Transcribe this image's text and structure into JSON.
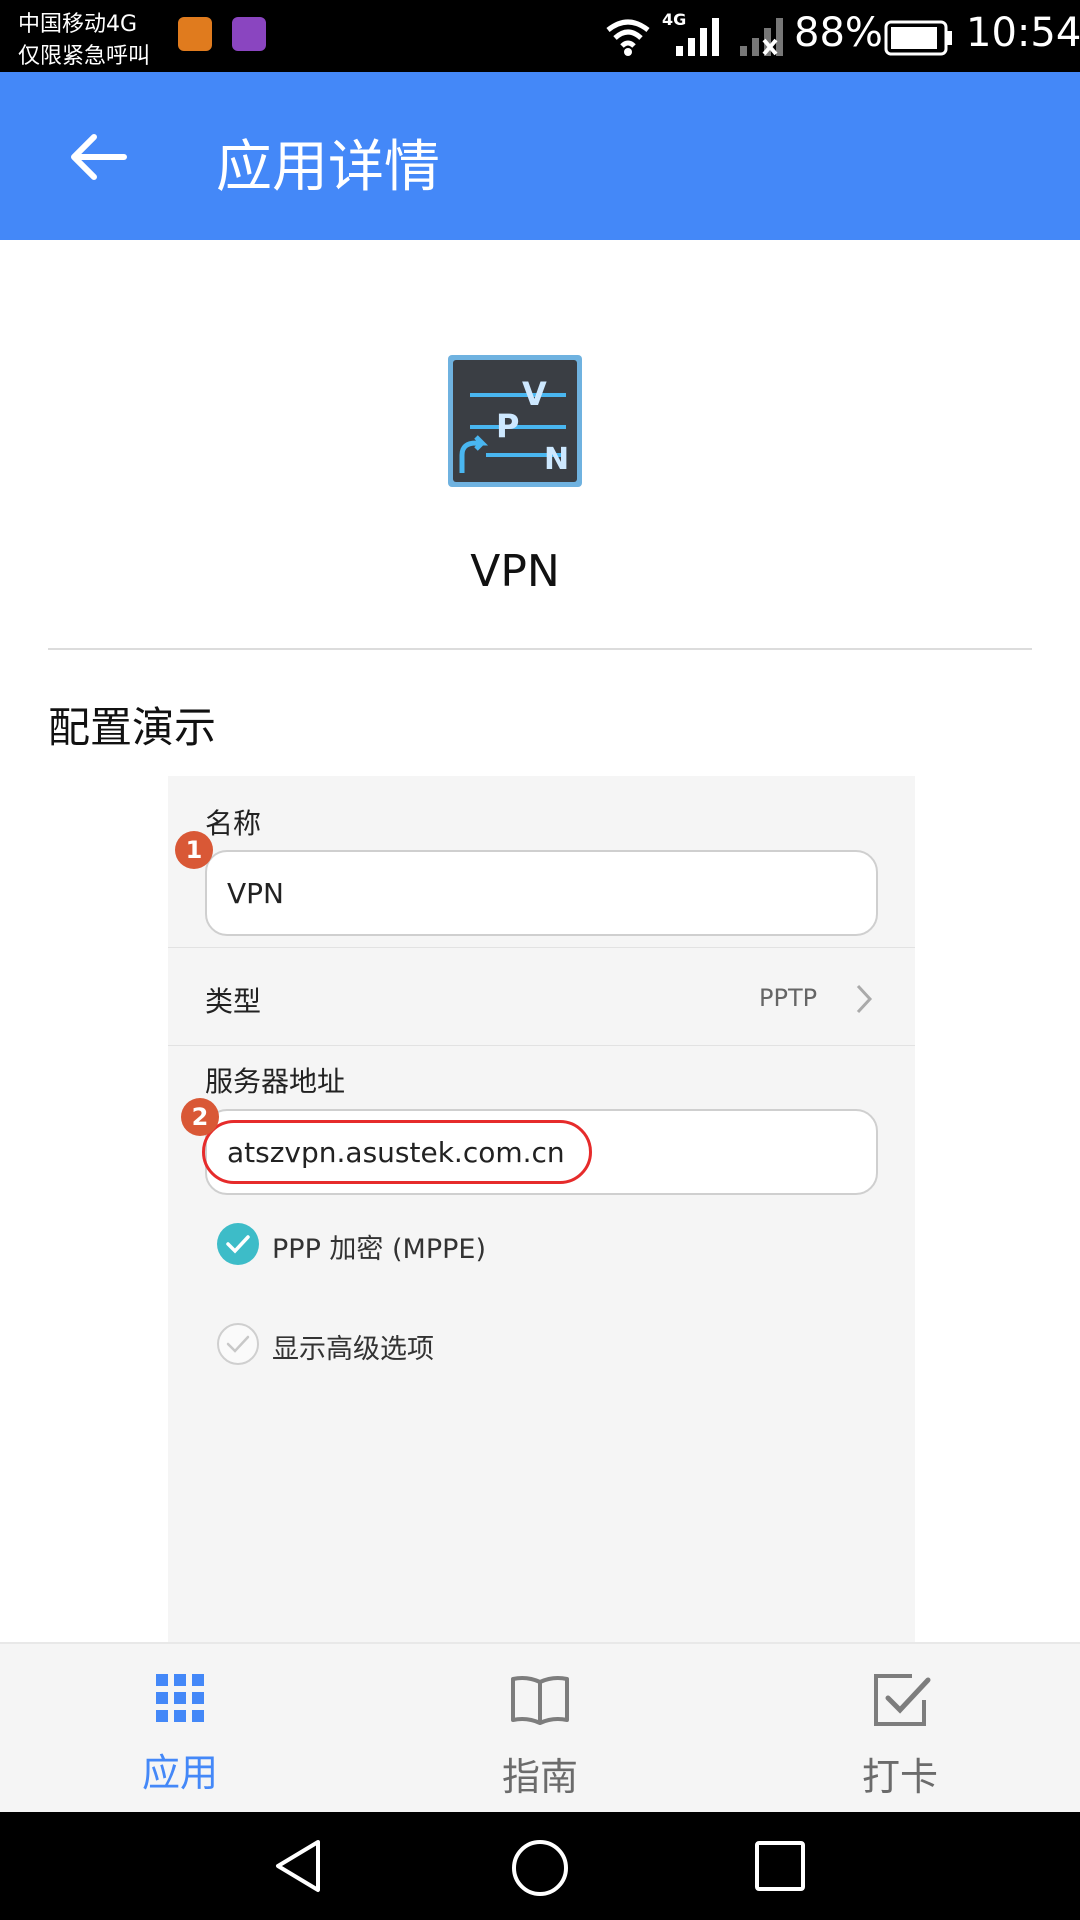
{
  "status_bar": {
    "carrier_line1": "中国移动4G",
    "carrier_line2": "仅限紧急呼叫",
    "network_type": "4G",
    "battery_percent": "88%",
    "time": "10:54"
  },
  "header": {
    "title": "应用详情",
    "back_icon": "arrow-left-icon"
  },
  "app": {
    "name": "VPN",
    "icon": "vpn-app-icon"
  },
  "section": {
    "title": "配置演示"
  },
  "form": {
    "name_label": "名称",
    "name_value": "VPN",
    "type_label": "类型",
    "type_value": "PPTP",
    "server_label": "服务器地址",
    "server_value": "atszvpn.asustek.com.cn",
    "ppp_encryption_label": "PPP 加密 (MPPE)",
    "ppp_encryption_checked": true,
    "advanced_label": "显示高级选项",
    "advanced_checked": false,
    "badge1": "1",
    "badge2": "2"
  },
  "bottom_nav": {
    "items": [
      {
        "label": "应用",
        "icon": "grid-icon",
        "active": true
      },
      {
        "label": "指南",
        "icon": "book-icon",
        "active": false
      },
      {
        "label": "打卡",
        "icon": "checkbox-icon",
        "active": false
      }
    ]
  },
  "colors": {
    "accent": "#4488f8",
    "badge": "#d95836",
    "check": "#3dbcc8",
    "highlight_ring": "#e62b2b"
  }
}
